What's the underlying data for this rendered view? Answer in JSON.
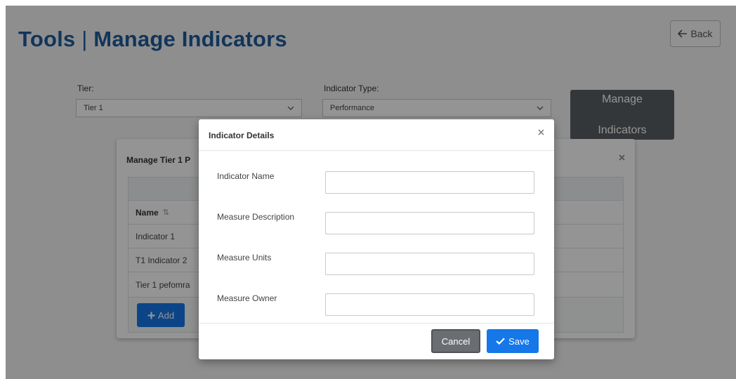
{
  "page": {
    "title_left": "Tools",
    "title_separator": "|",
    "title_right": "Manage Indicators",
    "back_icon": "arrow-left-icon",
    "back_label": "Back"
  },
  "filters": {
    "tier_label": "Tier:",
    "tier_value": "Tier 1",
    "indicator_type_label": "Indicator Type:",
    "indicator_type_value": "Performance",
    "manage_button_line1": "Manage",
    "manage_button_line2": "Indicators"
  },
  "background_modal": {
    "title": "Manage Tier 1 P",
    "close_icon": "close-icon",
    "column_header": "Name",
    "rows": [
      "Indicator 1",
      "T1 Indicator 2",
      "Tier 1 pefomra"
    ],
    "add_icon": "plus-icon",
    "add_label": "Add"
  },
  "indicator_dialog": {
    "title": "Indicator Details",
    "close_icon": "close-icon",
    "fields": [
      {
        "label": "Indicator Name",
        "value": ""
      },
      {
        "label": "Measure Description",
        "value": ""
      },
      {
        "label": "Measure Units",
        "value": ""
      },
      {
        "label": "Measure Owner",
        "value": ""
      }
    ],
    "cancel_label": "Cancel",
    "save_icon": "check-icon",
    "save_label": "Save"
  },
  "colors": {
    "brand_blue": "#1f5c99",
    "primary_button": "#1677e8",
    "dark_button": "#5b5f64"
  }
}
